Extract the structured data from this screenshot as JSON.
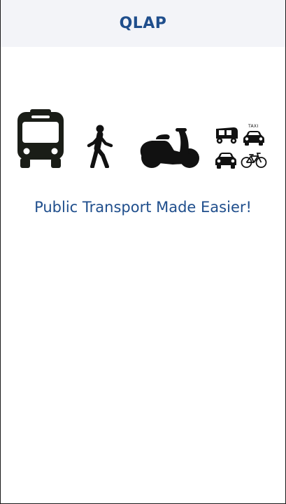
{
  "header": {
    "title": "QLAP"
  },
  "hero": {
    "icons": [
      "bus-icon",
      "pedestrian-icon",
      "scooter-icon",
      "auto-rickshaw-icon",
      "taxi-icon",
      "car-icon",
      "bicycle-icon"
    ],
    "taxi_sign": "TAXI"
  },
  "tagline": "Public Transport Made Easier!",
  "colors": {
    "brand": "#1f4e8c",
    "header_bg": "#f3f4f8",
    "icon": "#111111"
  }
}
